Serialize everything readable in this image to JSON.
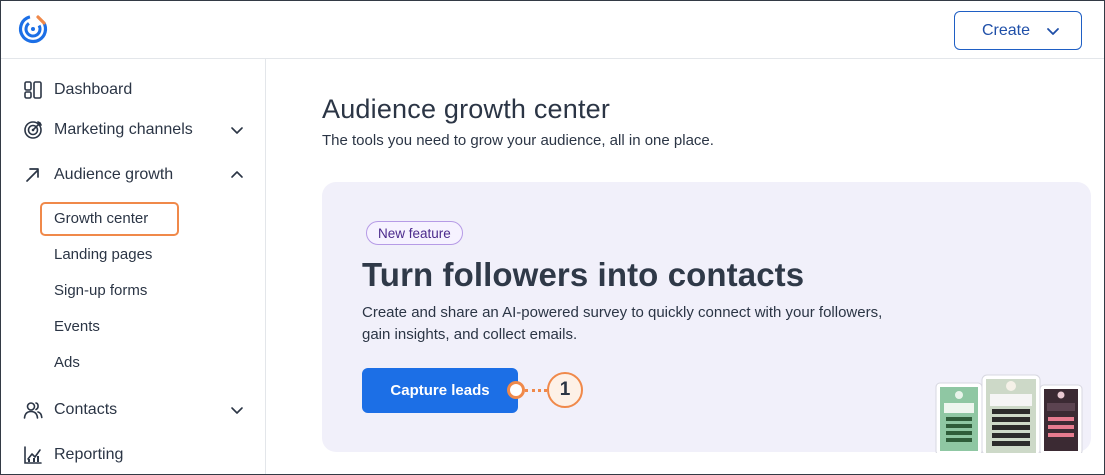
{
  "header": {
    "logo": "constant-contact-logo",
    "create_label": "Create"
  },
  "sidebar": {
    "items": [
      {
        "label": "Dashboard",
        "icon": "dashboard-icon"
      },
      {
        "label": "Marketing channels",
        "icon": "target-icon"
      },
      {
        "label": "Audience growth",
        "icon": "arrow-up-right-icon"
      },
      {
        "label": "Contacts",
        "icon": "contacts-icon"
      },
      {
        "label": "Reporting",
        "icon": "reporting-icon"
      }
    ],
    "sub_items": [
      "Growth center",
      "Landing pages",
      "Sign-up forms",
      "Events",
      "Ads"
    ],
    "active_sub": "Growth center"
  },
  "main": {
    "title": "Audience growth center",
    "subtitle": "The tools you need to grow your audience, all in one place.",
    "card": {
      "badge": "New feature",
      "title": "Turn followers into contacts",
      "description": "Create and share an AI-powered survey to quickly connect with your followers, gain insights, and collect emails.",
      "cta_label": "Capture leads"
    },
    "callout_number": "1"
  },
  "colors": {
    "accent": "#1c6fe6",
    "callout": "#f0894a",
    "card_bg": "#f1f0fa",
    "badge_text": "#4b2a8c"
  }
}
